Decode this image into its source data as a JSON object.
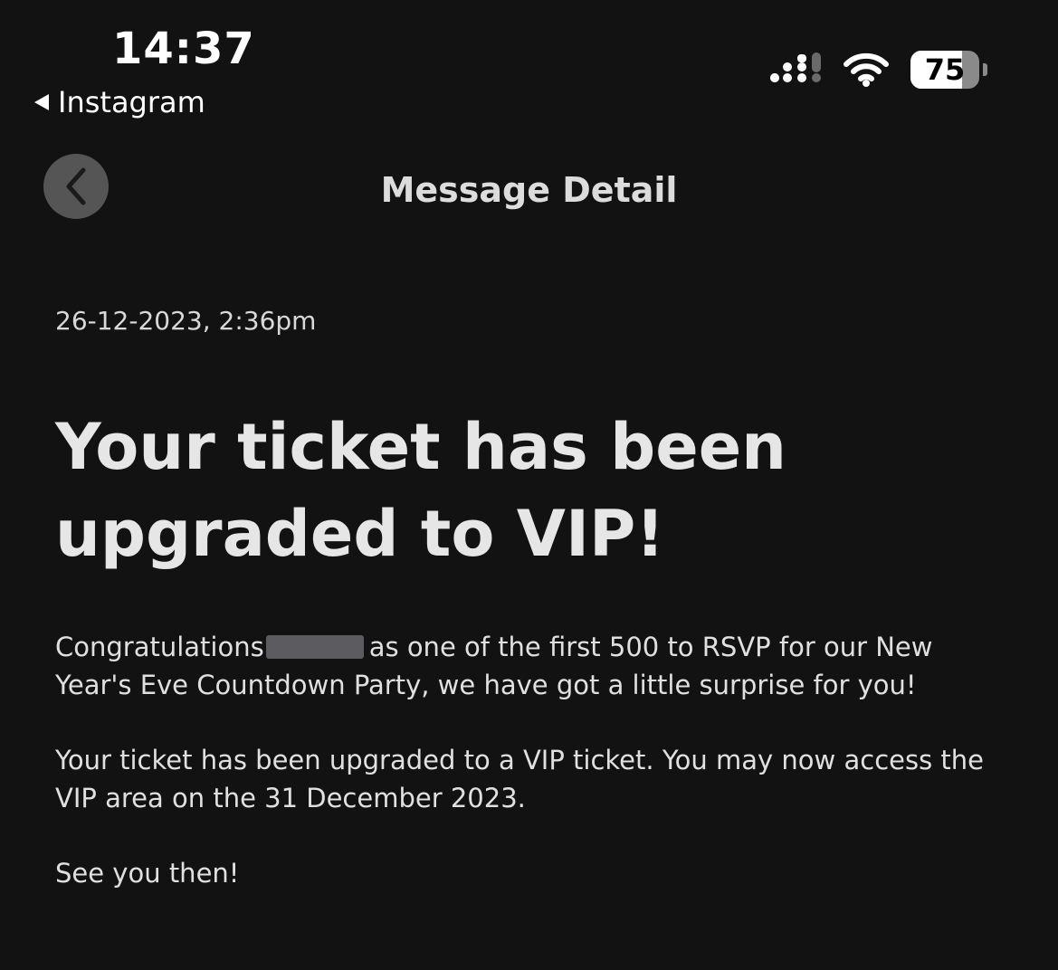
{
  "status_bar": {
    "time": "14:37",
    "back_app": "Instagram",
    "battery": "75",
    "battery_level": 0.75
  },
  "header": {
    "title": "Message Detail",
    "back_icon": "chevron-left-icon"
  },
  "message": {
    "timestamp": "26-12-2023, 2:36pm",
    "headline": "Your ticket has been upgraded to VIP!",
    "para1_before": "Congratulations",
    "para1_after": "as one of the first 500 to RSVP for our New Year's Eve Countdown Party, we have got a little surprise for you!",
    "para2": "Your ticket has been upgraded to a VIP ticket. You may now access the VIP area on the 31 December 2023.",
    "para3": "See you then!"
  },
  "colors": {
    "background": "#121212",
    "back_button": "#555555",
    "text": "#e6e6e6"
  }
}
